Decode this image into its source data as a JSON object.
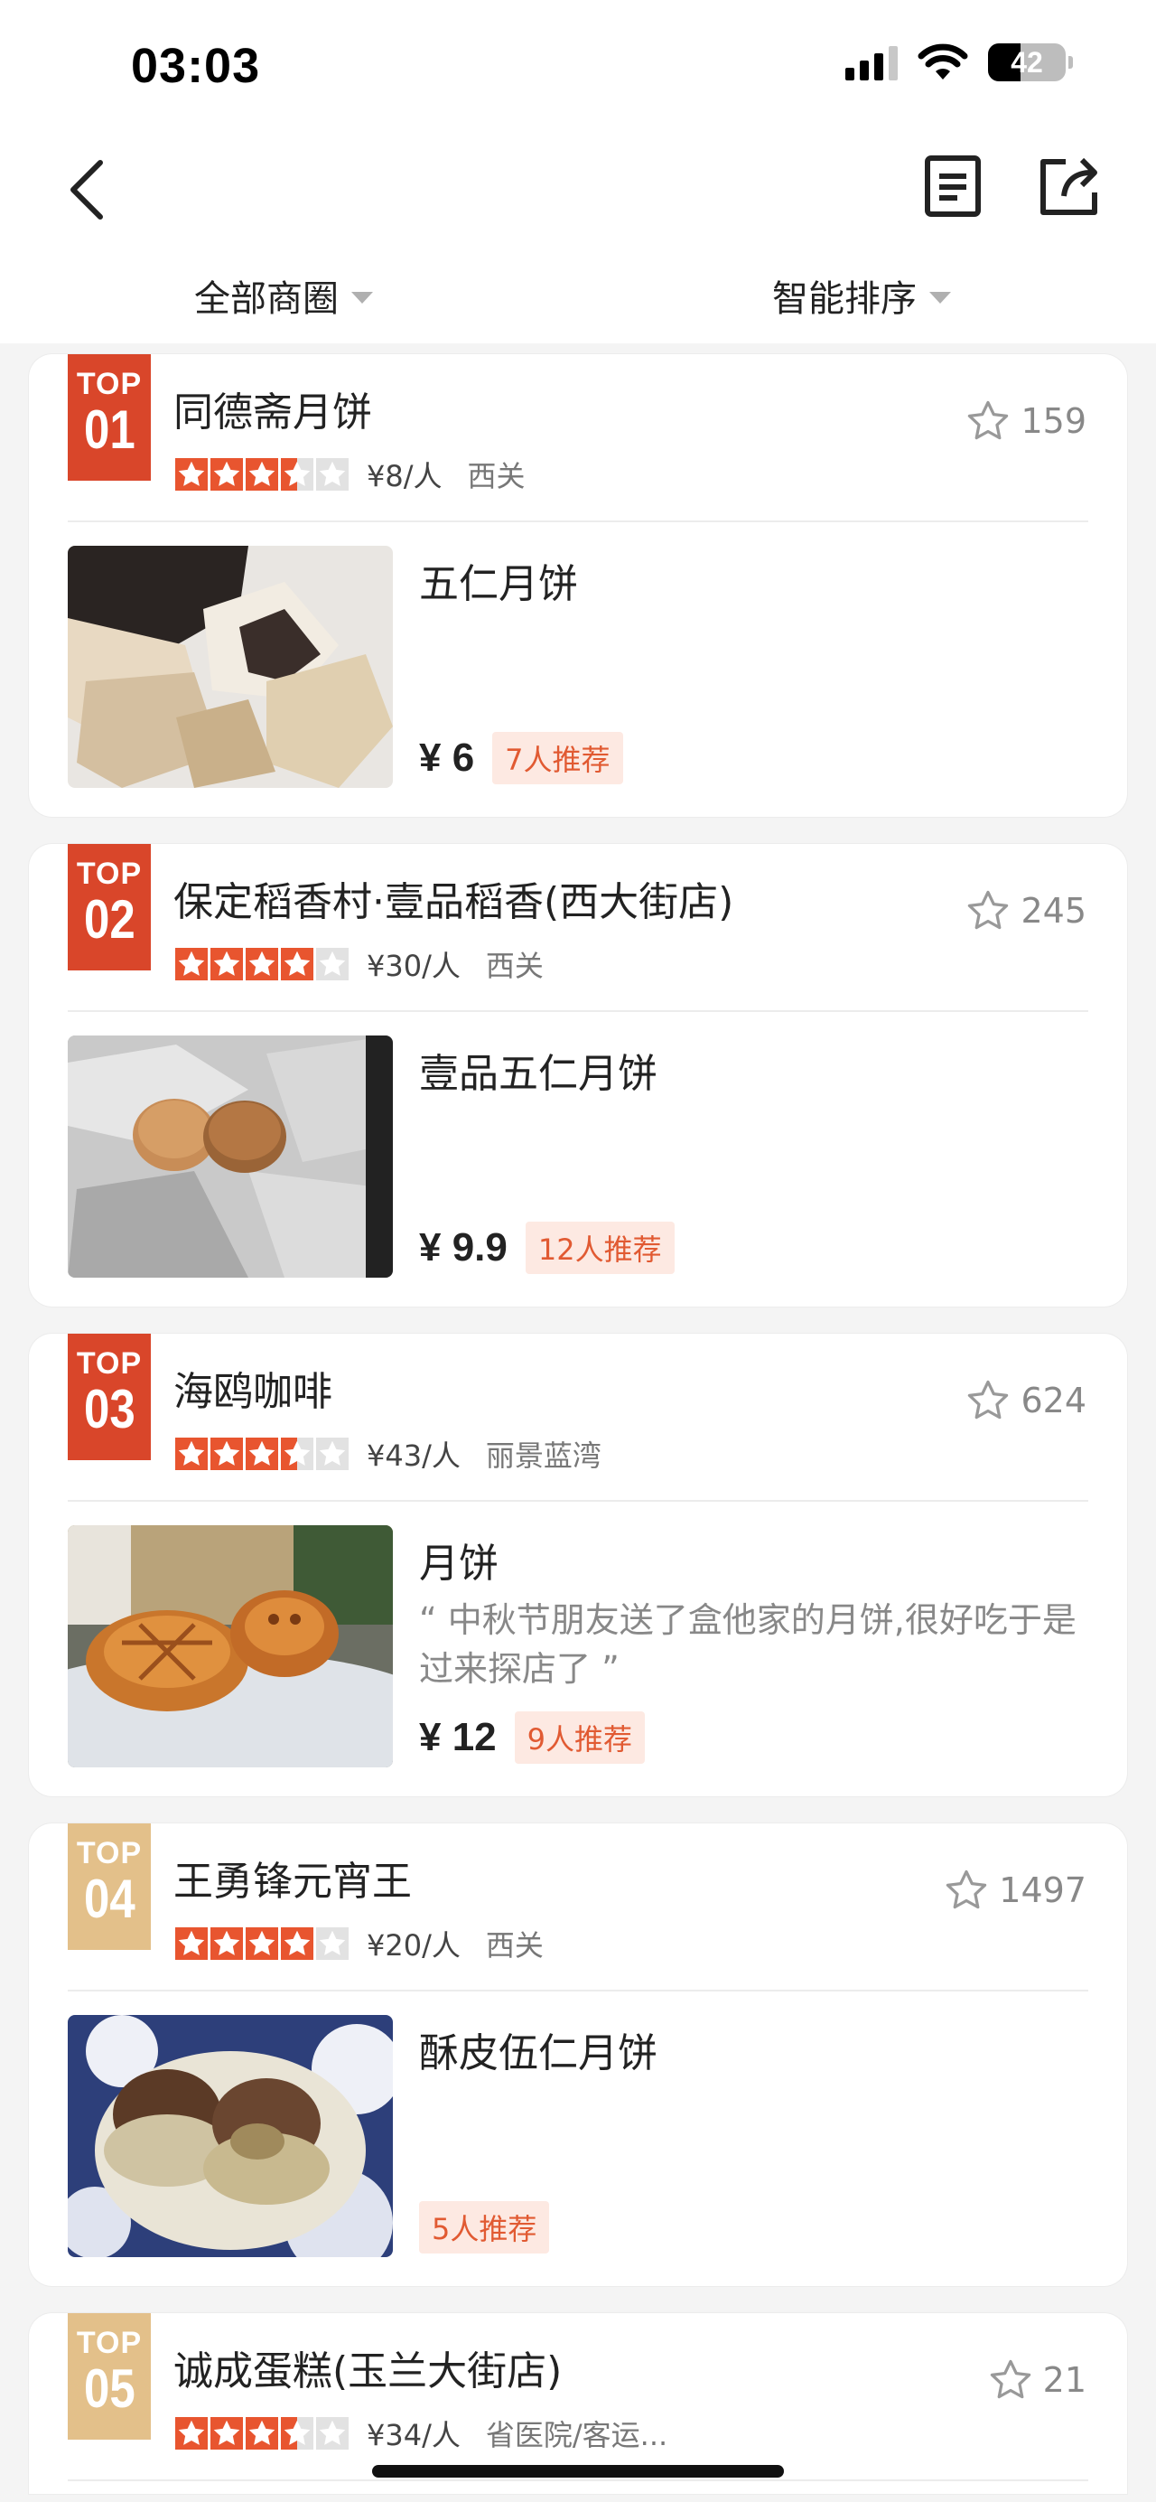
{
  "status_bar": {
    "time": "03:03",
    "battery": "42"
  },
  "filters": {
    "area": "全部商圈",
    "sort": "智能排序"
  },
  "shops": [
    {
      "rank_label": "TOP",
      "rank": "01",
      "tier": "hot",
      "name": "同德斋月饼",
      "rating": 3.5,
      "per_price": "¥8/人",
      "area": "西关",
      "favorites": "159",
      "dish": {
        "name": "五仁月饼",
        "review": "",
        "price": "¥ 6",
        "recommend": "7人推荐"
      }
    },
    {
      "rank_label": "TOP",
      "rank": "02",
      "tier": "hot",
      "name": "保定稻香村·壹品稻香(西大街店)",
      "rating": 4,
      "per_price": "¥30/人",
      "area": "西关",
      "favorites": "245",
      "dish": {
        "name": "壹品五仁月饼",
        "review": "",
        "price": "¥ 9.9",
        "recommend": "12人推荐"
      }
    },
    {
      "rank_label": "TOP",
      "rank": "03",
      "tier": "hot",
      "name": "海鸥咖啡",
      "rating": 3.5,
      "per_price": "¥43/人",
      "area": "丽景蓝湾",
      "favorites": "624",
      "dish": {
        "name": "月饼",
        "review": "“ 中秋节朋友送了盒他家的月饼,很好吃于是过来探店了 ”",
        "price": "¥ 12",
        "recommend": "9人推荐"
      }
    },
    {
      "rank_label": "TOP",
      "rank": "04",
      "tier": "warm",
      "name": "王勇锋元宵王",
      "rating": 4,
      "per_price": "¥20/人",
      "area": "西关",
      "favorites": "1497",
      "dish": {
        "name": "酥皮伍仁月饼",
        "review": "",
        "price": "",
        "recommend": "5人推荐"
      }
    },
    {
      "rank_label": "TOP",
      "rank": "05",
      "tier": "warm",
      "name": "诚成蛋糕(玉兰大街店)",
      "rating": 3.5,
      "per_price": "¥34/人",
      "area": "省医院/客运...",
      "favorites": "21"
    }
  ],
  "colors": {
    "hot_badge": "#d9462a",
    "warm_badge": "#e3c08a",
    "star": "#e8552f",
    "recommend_bg": "#fde9e2",
    "recommend_text": "#e15a32"
  },
  "icons": {
    "back": "chevron-left-icon",
    "list": "document-list-icon",
    "share": "share-icon",
    "favorite": "star-outline-icon"
  }
}
